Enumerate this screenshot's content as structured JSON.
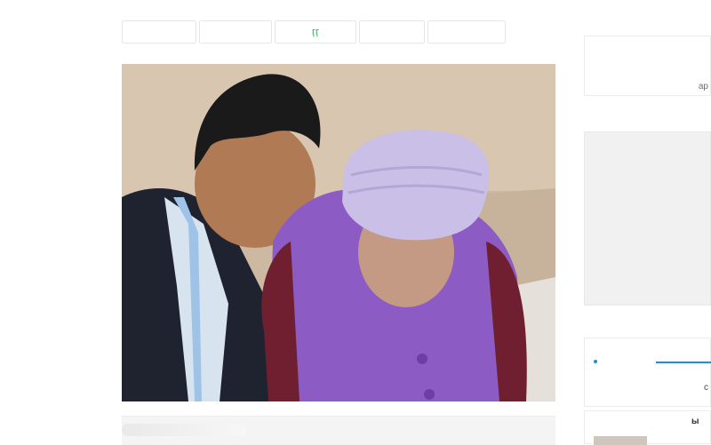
{
  "tabs": [
    {
      "label": ""
    },
    {
      "label": ""
    },
    {
      "label": "ӷӷ"
    },
    {
      "label": ""
    },
    {
      "label": ""
    }
  ],
  "sidebar": {
    "top_label": "ар",
    "lower_glyph": "с",
    "bottom_label": "ы"
  },
  "colors": {
    "accent": "#1e8fd6",
    "tab_text": "#3aa35a",
    "wall": "#cdb8a2",
    "headscarf": "#c9bfe7",
    "vest": "#8c5cc4",
    "jacket": "#1f2330"
  }
}
